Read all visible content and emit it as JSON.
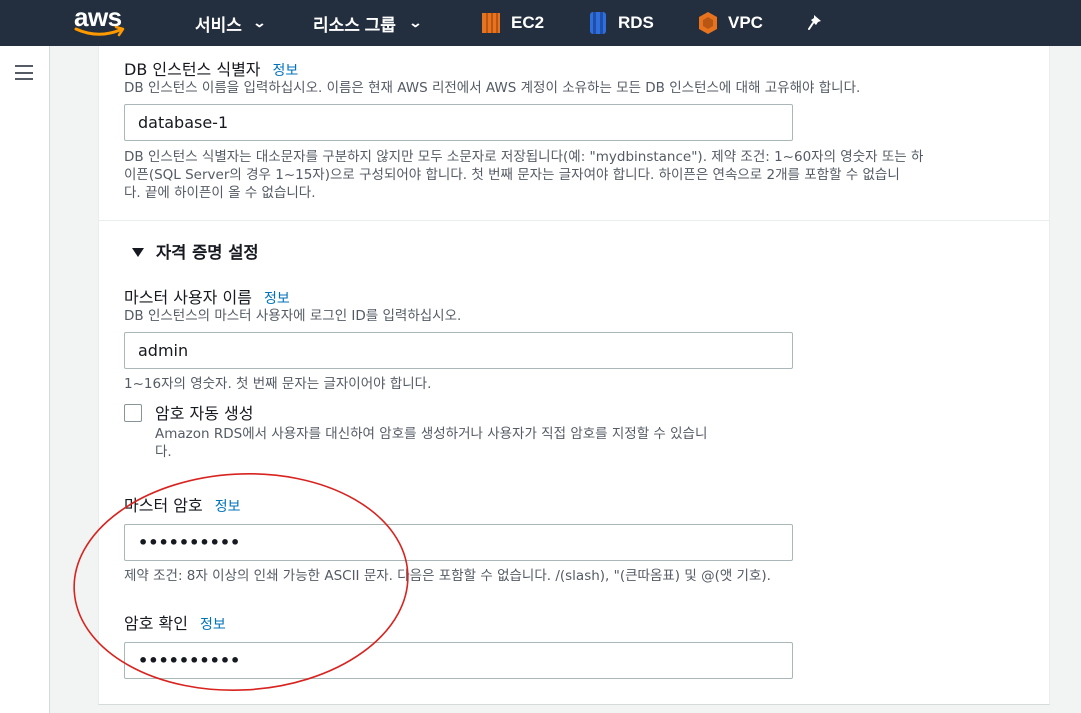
{
  "nav": {
    "logo": "aws",
    "services": "서비스",
    "resource_groups": "리소스 그룹",
    "ec2": "EC2",
    "rds": "RDS",
    "vpc": "VPC",
    "pin_icon": "pin-icon",
    "colors": {
      "bar": "#232f3e",
      "ec2": "#e7731f",
      "rds": "#2f6fdb",
      "vpc": "#e7731f",
      "smile": "#ff9900"
    }
  },
  "db_identifier": {
    "label": "DB 인스턴스 식별자",
    "info": "정보",
    "desc": "DB 인스턴스 이름을 입력하십시오. 이름은 현재 AWS 리전에서 AWS 계정이 소유하는 모든 DB 인스턴스에 대해 고유해야 합니다.",
    "value": "database-1",
    "hint_line1": "DB 인스턴스 식별자는 대소문자를 구분하지 않지만 모두 소문자로 저장됩니다(예: \"mydbinstance\"). 제약 조건: 1~60자의 영숫자 또는 하",
    "hint_line2": "이픈(SQL Server의 경우 1~15자)으로 구성되어야 합니다. 첫 번째 문자는 글자여야 합니다. 하이픈은 연속으로 2개를 포함할 수 없습니",
    "hint_line3": "다. 끝에 하이픈이 올 수 없습니다."
  },
  "credentials": {
    "section_title": "자격 증명 설정",
    "master_username": {
      "label": "마스터 사용자 이름",
      "info": "정보",
      "desc": "DB 인스턴스의 마스터 사용자에 로그인 ID를 입력하십시오.",
      "value": "admin",
      "hint": "1~16자의 영숫자. 첫 번째 문자는 글자이어야 합니다."
    },
    "auto_password": {
      "label": "암호 자동 생성",
      "checked": false,
      "desc_line1": "Amazon RDS에서 사용자를 대신하여 암호를 생성하거나 사용자가 직접 암호를 지정할 수 있습니",
      "desc_line2": "다."
    },
    "master_password": {
      "label": "마스터 암호",
      "info": "정보",
      "value": "••••••••••",
      "hint": "제약 조건: 8자 이상의 인쇄 가능한 ASCII 문자. 다음은 포함할 수 없습니다. /(slash), \"(큰따옴표) 및 @(앳 기호)."
    },
    "confirm_password": {
      "label": "암호 확인",
      "info": "정보",
      "value": "••••••••••"
    }
  },
  "annotation": {
    "color": "#d8231f"
  }
}
